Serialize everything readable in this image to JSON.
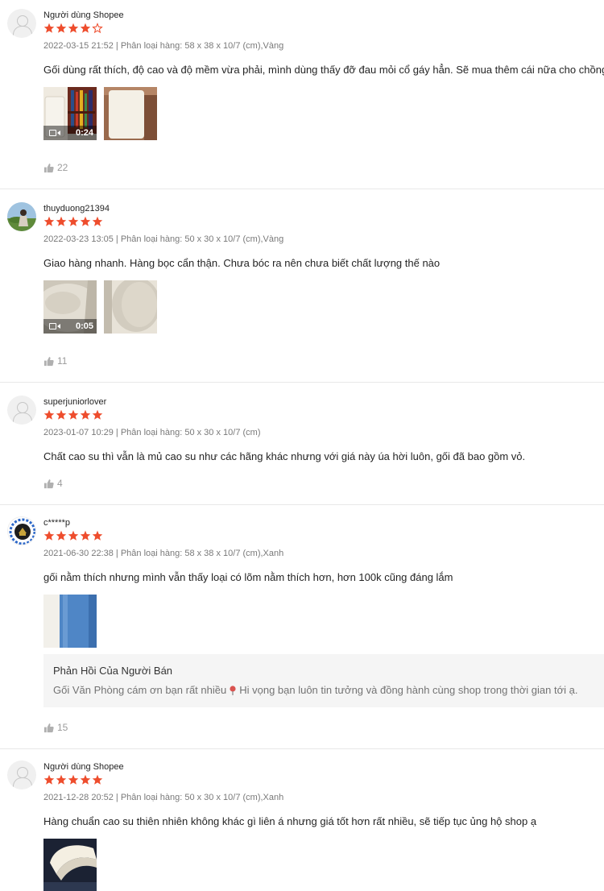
{
  "colors": {
    "star": "#ee4d2d",
    "star_empty_stroke": "#ee4d2d"
  },
  "reviews": [
    {
      "username": "Người dùng Shopee",
      "avatar": "default-avatar-icon",
      "rating": 4,
      "meta": "2022-03-15 21:52 | Phân loại hàng: 58 x 38 x 10/7 (cm),Vàng",
      "content": "Gối dùng rất thích, độ cao và độ mềm vừa phải, mình dùng thấy đỡ đau mỏi cổ gáy hẳn. Sẽ mua thêm cái nữa cho chồng.",
      "video_duration": "0:24",
      "likes": "22"
    },
    {
      "username": "thuyduong21394",
      "avatar": "user-photo-avatar",
      "rating": 5,
      "meta": "2022-03-23 13:05 | Phân loại hàng: 50 x 30 x 10/7 (cm),Vàng",
      "content": "Giao hàng nhanh. Hàng bọc cẩn thận. Chưa bóc ra nên chưa biết chất lượng thế nào",
      "video_duration": "0:05",
      "likes": "11"
    },
    {
      "username": "superjuniorlover",
      "avatar": "default-avatar-icon",
      "rating": 5,
      "meta": "2023-01-07 10:29 | Phân loại hàng: 50 x 30 x 10/7 (cm)",
      "content": "Chất cao su thì vẫn là mủ cao su như các hãng khác nhưng với giá này úa hời luôn, gối đã bao gồm vỏ.",
      "likes": "4"
    },
    {
      "username": "c*****p",
      "avatar": "badge-logo-avatar",
      "rating": 5,
      "meta": "2021-06-30 22:38 | Phân loại hàng: 58 x 38 x 10/7 (cm),Xanh",
      "content": "gối nằm thích nhưng mình vẫn thấy loại có lõm nằm thích hơn, hơn 100k cũng đáng lắm",
      "seller_reply": {
        "title": "Phản Hồi Của Người Bán",
        "text_before": "Gối Văn Phòng cám ơn bạn rất nhiều",
        "emoji": "pushpin-emoji",
        "text_after": "Hi vọng bạn luôn tin tưởng và đồng hành cùng shop trong thời gian tới ạ."
      },
      "likes": "15"
    },
    {
      "username": "Người dùng Shopee",
      "avatar": "default-avatar-icon",
      "rating": 5,
      "meta": "2021-12-28 20:52 | Phân loại hàng: 50 x 30 x 10/7 (cm),Xanh",
      "content": "Hàng chuẩn cao su thiên nhiên không khác gì liên á nhưng giá tốt hơn rất nhiều, sẽ tiếp tục ủng hộ shop ạ"
    }
  ]
}
